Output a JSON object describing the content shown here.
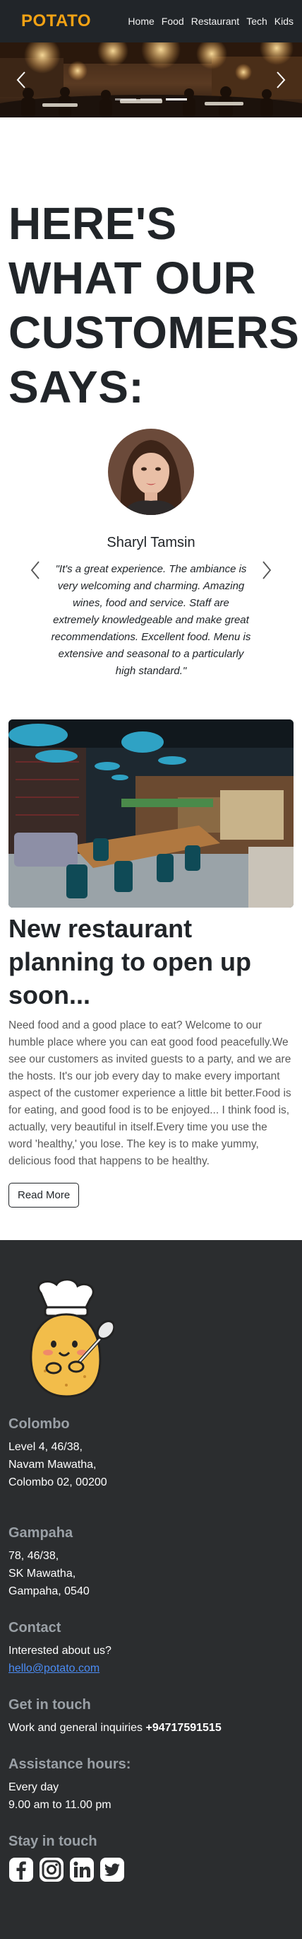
{
  "navbar": {
    "brand": "POTATO",
    "links": [
      "Home",
      "Food",
      "Restaurant",
      "Tech",
      "Kids"
    ]
  },
  "carousel": {
    "slide_count": 3,
    "active_slide": 3
  },
  "testimonials": {
    "heading": "HERE'S WHAT OUR CUSTOMERS SAYS:",
    "reviewer_name": "Sharyl Tamsin",
    "quote": "\"It's a great experience. The ambiance is very welcoming and charming. Amazing wines, food and service. Staff are extremely knowledgeable and make great recommendations. Excellent food. Menu is extensive and seasonal to a particularly high standard.\""
  },
  "article": {
    "title": "New restaurant planning to open up soon...",
    "body": "Need food and a good place to eat? Welcome to our humble place where you can eat good food peacefully.We see our customers as invited guests to a party, and we are the hosts. It's our job every day to make every important aspect of the customer experience a little bit better.Food is for eating, and good food is to be enjoyed... I think food is, actually, very beautiful in itself.Every time you use the word 'healthy,' you lose. The key is to make yummy, delicious food that happens to be healthy.",
    "button": "Read More"
  },
  "footer": {
    "colombo": {
      "heading": "Colombo",
      "lines": [
        "Level 4, 46/38,",
        "Navam Mawatha,",
        "Colombo 02, 00200"
      ]
    },
    "gampaha": {
      "heading": "Gampaha",
      "lines": [
        "78, 46/38,",
        "SK Mawatha,",
        "Gampaha, 0540"
      ]
    },
    "contact": {
      "heading": "Contact",
      "text": "Interested about us?",
      "email": "hello@potato.com"
    },
    "get_in_touch": {
      "heading": "Get in touch",
      "text": "Work and general inquiries ",
      "phone": "+94717591515"
    },
    "hours": {
      "heading": "Assistance hours:",
      "lines": [
        "Every day",
        "9.00 am to 11.00 pm"
      ]
    },
    "stay": {
      "heading": "Stay in touch"
    },
    "social_icons": [
      "facebook-icon",
      "instagram-icon",
      "linkedin-icon",
      "twitter-icon"
    ]
  },
  "colors": {
    "navbar_bg": "#212529",
    "brand": "#f3a214",
    "footer_bg": "#2b2d2f",
    "footer_heading": "#9aa0a6",
    "link": "#4b8cf5"
  }
}
